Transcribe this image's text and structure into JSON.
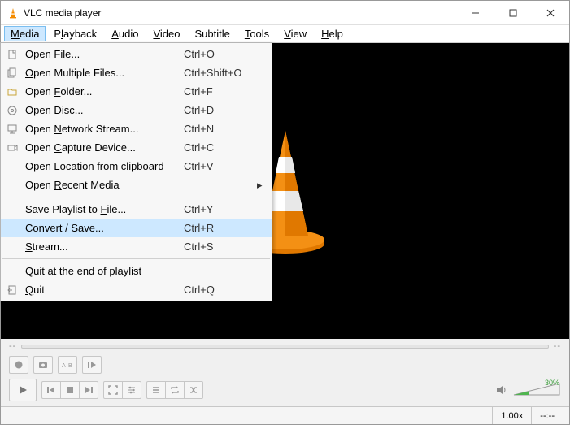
{
  "window": {
    "title": "VLC media player"
  },
  "menubar": {
    "items": [
      {
        "label": "Media",
        "accel": "M",
        "open": true
      },
      {
        "label": "Playback",
        "accel": "l"
      },
      {
        "label": "Audio",
        "accel": "A"
      },
      {
        "label": "Video",
        "accel": "V"
      },
      {
        "label": "Subtitle",
        "accel": ""
      },
      {
        "label": "Tools",
        "accel": "T"
      },
      {
        "label": "View",
        "accel": "V"
      },
      {
        "label": "Help",
        "accel": "H"
      }
    ]
  },
  "media_menu": {
    "items": [
      {
        "icon": "file",
        "label": "Open File...",
        "accel": "O",
        "shortcut": "Ctrl+O"
      },
      {
        "icon": "files",
        "label": "Open Multiple Files...",
        "accel": "O",
        "shortcut": "Ctrl+Shift+O"
      },
      {
        "icon": "folder",
        "label": "Open Folder...",
        "accel": "F",
        "shortcut": "Ctrl+F"
      },
      {
        "icon": "disc",
        "label": "Open Disc...",
        "accel": "D",
        "shortcut": "Ctrl+D"
      },
      {
        "icon": "network",
        "label": "Open Network Stream...",
        "accel": "N",
        "shortcut": "Ctrl+N"
      },
      {
        "icon": "capture",
        "label": "Open Capture Device...",
        "accel": "C",
        "shortcut": "Ctrl+C"
      },
      {
        "icon": "",
        "label": "Open Location from clipboard",
        "accel": "L",
        "shortcut": "Ctrl+V"
      },
      {
        "icon": "",
        "label": "Open Recent Media",
        "accel": "R",
        "shortcut": "",
        "submenu": true
      },
      {
        "sep": true
      },
      {
        "icon": "",
        "label": "Save Playlist to File...",
        "accel": "F",
        "shortcut": "Ctrl+Y"
      },
      {
        "icon": "",
        "label": "Convert / Save...",
        "accel": "R",
        "shortcut": "Ctrl+R",
        "highlight": true
      },
      {
        "icon": "",
        "label": "Stream...",
        "accel": "S",
        "shortcut": "Ctrl+S"
      },
      {
        "sep": true
      },
      {
        "icon": "",
        "label": "Quit at the end of playlist",
        "accel": "",
        "shortcut": ""
      },
      {
        "icon": "quit",
        "label": "Quit",
        "accel": "Q",
        "shortcut": "Ctrl+Q"
      }
    ]
  },
  "status": {
    "time_left": "--:--",
    "time_right": "--:--",
    "speed": "1.00x",
    "volume_pct": "30%"
  }
}
